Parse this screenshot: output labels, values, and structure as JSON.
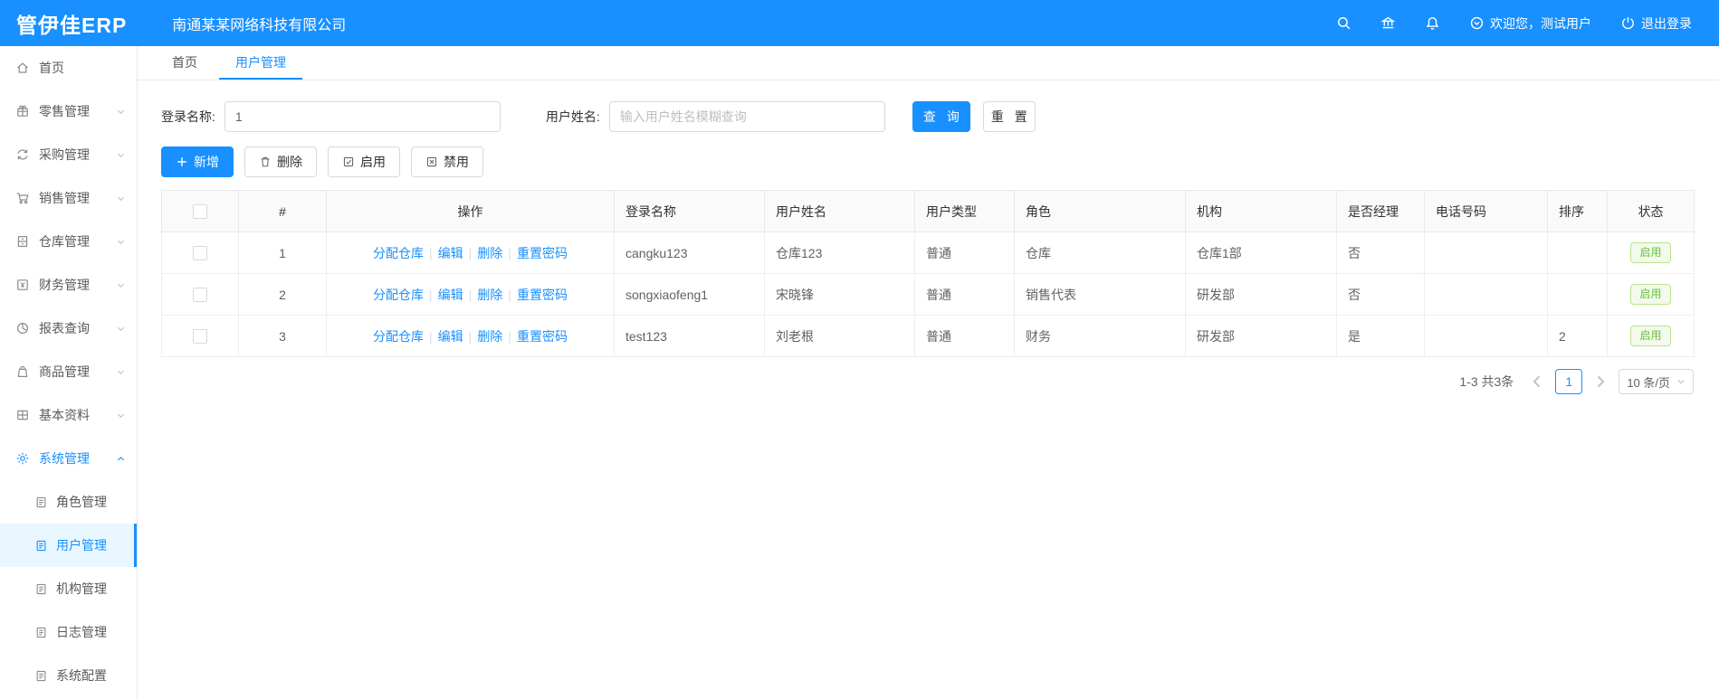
{
  "colors": {
    "primary": "#1890ff",
    "success": "#67c23a"
  },
  "header": {
    "logo": "管伊佳ERP",
    "company": "南通某某网络科技有限公司",
    "welcome": "欢迎您，测试用户",
    "logout": "退出登录"
  },
  "tabs": [
    {
      "label": "首页"
    },
    {
      "label": "用户管理"
    }
  ],
  "sidebar": {
    "items": [
      {
        "label": "首页"
      },
      {
        "label": "零售管理"
      },
      {
        "label": "采购管理"
      },
      {
        "label": "销售管理"
      },
      {
        "label": "仓库管理"
      },
      {
        "label": "财务管理"
      },
      {
        "label": "报表查询"
      },
      {
        "label": "商品管理"
      },
      {
        "label": "基本资料"
      },
      {
        "label": "系统管理"
      }
    ],
    "sub_items": [
      {
        "label": "角色管理"
      },
      {
        "label": "用户管理"
      },
      {
        "label": "机构管理"
      },
      {
        "label": "日志管理"
      },
      {
        "label": "系统配置"
      }
    ]
  },
  "search": {
    "login_label": "登录名称:",
    "login_value": "1",
    "name_label": "用户姓名:",
    "name_placeholder": "输入用户姓名模糊查询",
    "query": "查 询",
    "reset": "重 置"
  },
  "toolbar": {
    "add": "新增",
    "delete": "删除",
    "enable": "启用",
    "disable": "禁用"
  },
  "table": {
    "headers": {
      "num": "#",
      "ops": "操作",
      "login": "登录名称",
      "name": "用户姓名",
      "type": "用户类型",
      "role": "角色",
      "org": "机构",
      "manager": "是否经理",
      "phone": "电话号码",
      "sort": "排序",
      "status": "状态"
    },
    "op_links": [
      "分配仓库",
      "编辑",
      "删除",
      "重置密码"
    ],
    "rows": [
      {
        "num": "1",
        "login": "cangku123",
        "name": "仓库123",
        "type": "普通",
        "role": "仓库",
        "org": "仓库1部",
        "manager": "否",
        "phone": "",
        "sort": "",
        "status": "启用"
      },
      {
        "num": "2",
        "login": "songxiaofeng1",
        "name": "宋晓锋",
        "type": "普通",
        "role": "销售代表",
        "org": "研发部",
        "manager": "否",
        "phone": "",
        "sort": "",
        "status": "启用"
      },
      {
        "num": "3",
        "login": "test123",
        "name": "刘老根",
        "type": "普通",
        "role": "财务",
        "org": "研发部",
        "manager": "是",
        "phone": "",
        "sort": "2",
        "status": "启用"
      }
    ]
  },
  "pagination": {
    "total": "1-3 共3条",
    "page": "1",
    "size": "10 条/页"
  }
}
